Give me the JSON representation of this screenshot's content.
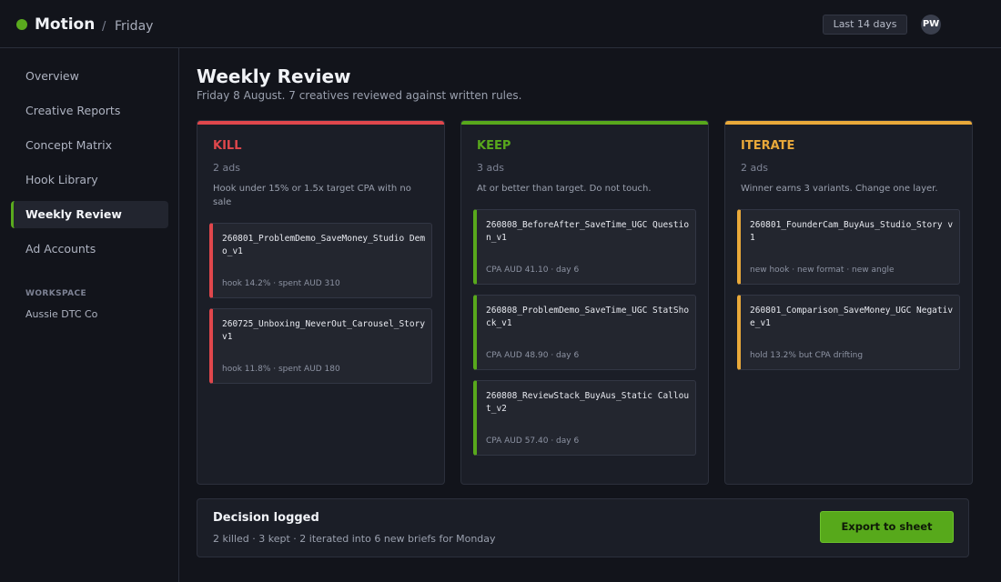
{
  "app": {
    "name": "Motion",
    "crumb_sep": "/",
    "crumb": "Friday",
    "range": "Last 14 days",
    "avatar": "PW",
    "brand_color": "#5aaa1e"
  },
  "sidebar": {
    "items": [
      {
        "label": "Overview"
      },
      {
        "label": "Creative Reports"
      },
      {
        "label": "Concept Matrix"
      },
      {
        "label": "Hook Library"
      },
      {
        "label": "Weekly Review",
        "active": true
      },
      {
        "label": "Ad Accounts"
      }
    ],
    "workspace_label": "WORKSPACE",
    "workspace_name": "Aussie DTC Co"
  },
  "page": {
    "title": "Weekly Review",
    "subtitle": "Friday 8 August. 7 creatives reviewed against written rules."
  },
  "columns": [
    {
      "title": "KILL",
      "count": "2 ads",
      "color": "#e0474c",
      "rule": "Hook under 15% or 1.5x target CPA with no sale",
      "cards": [
        {
          "name": "260801_ProblemDemo_SaveMoney_Studio Demo_v1",
          "meta": [
            "hook 14.2%",
            "spent AUD 310"
          ]
        },
        {
          "name": "260725_Unboxing_NeverOut_Carousel_Story v1",
          "meta": [
            "hook 11.8%",
            "spent AUD 180"
          ]
        }
      ]
    },
    {
      "title": "KEEP",
      "count": "3 ads",
      "color": "#58a81c",
      "rule": "At or better than target. Do not touch.",
      "cards": [
        {
          "name": "260808_BeforeAfter_SaveTime_UGC Question_v1",
          "meta": [
            "CPA AUD 41.10",
            "day 6"
          ]
        },
        {
          "name": "260808_ProblemDemo_SaveTime_UGC StatShock_v1",
          "meta": [
            "CPA AUD 48.90",
            "day 6"
          ]
        },
        {
          "name": "260808_ReviewStack_BuyAus_Static Callout_v2",
          "meta": [
            "CPA AUD 57.40",
            "day 6"
          ]
        }
      ]
    },
    {
      "title": "ITERATE",
      "count": "2 ads",
      "color": "#e9a93a",
      "rule": "Winner earns 3 variants. Change one layer.",
      "cards": [
        {
          "name": "260801_FounderCam_BuyAus_Studio_Story v1",
          "meta": [
            "new hook",
            "new format",
            "new angle"
          ]
        },
        {
          "name": "260801_Comparison_SaveMoney_UGC Negative_v1",
          "meta": [
            "hold 13.2% but CPA drifting"
          ]
        }
      ]
    }
  ],
  "footer": {
    "title": "Decision logged",
    "summary": "2 killed · 3 kept · 2 iterated into 6 new briefs for Monday",
    "export_label": "Export to sheet"
  }
}
